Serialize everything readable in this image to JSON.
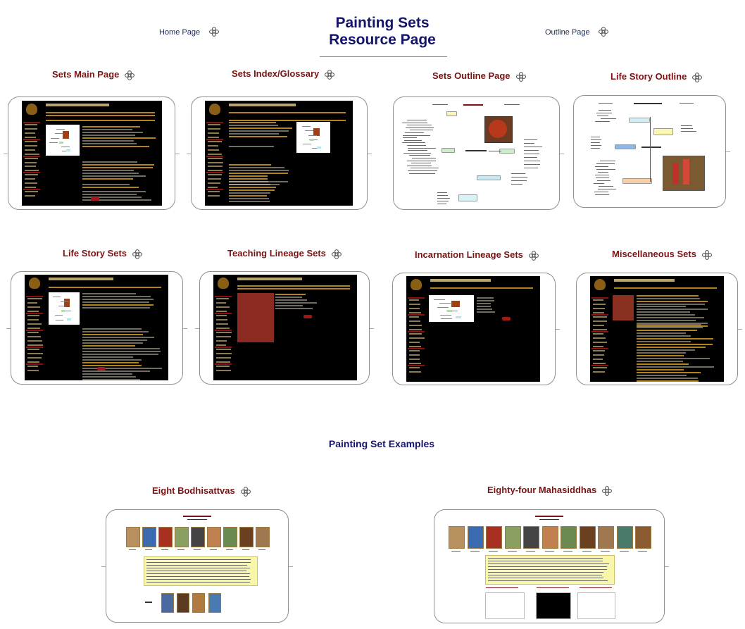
{
  "header": {
    "title_line1": "Painting Sets",
    "title_line2": "Resource Page",
    "home_link": "Home Page",
    "outline_link": "Outline Page",
    "link_icon": "endless-knot-icon"
  },
  "sections": [
    {
      "id": "sets-main-page",
      "label": "Sets Main Page",
      "preview": "dark-webpage"
    },
    {
      "id": "sets-index-glossary",
      "label": "Sets Index/Glossary",
      "preview": "dark-webpage"
    },
    {
      "id": "sets-outline-page",
      "label": "Sets Outline Page",
      "preview": "mind-map"
    },
    {
      "id": "life-story-outline",
      "label": "Life Story Outline",
      "preview": "mind-map"
    },
    {
      "id": "life-story-sets",
      "label": "Life Story Sets",
      "preview": "dark-webpage"
    },
    {
      "id": "teaching-lineage-sets",
      "label": "Teaching Lineage Sets",
      "preview": "dark-webpage"
    },
    {
      "id": "incarnation-lineage-sets",
      "label": "Incarnation Lineage Sets",
      "preview": "dark-webpage"
    },
    {
      "id": "miscellaneous-sets",
      "label": "Miscellaneous Sets",
      "preview": "dark-webpage"
    }
  ],
  "examples": {
    "heading": "Painting Set Examples",
    "items": [
      {
        "id": "eight-bodhisattvas",
        "label": "Eight Bodhisattvas",
        "preview": "painting-gallery"
      },
      {
        "id": "eighty-four-mahasiddhas",
        "label": "Eighty-four Mahasiddhas",
        "preview": "painting-gallery"
      }
    ]
  },
  "colors": {
    "title": "#14146b",
    "section_title": "#7a1414",
    "nav_link": "#1a2a55",
    "frame_border": "#8f8f8f",
    "preview_background": "#000000",
    "preview_link": "#d49a20",
    "highlight_box": "#f8f6a8"
  }
}
